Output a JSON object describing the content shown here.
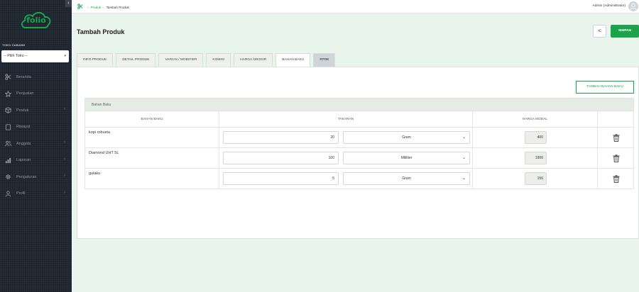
{
  "sidebar": {
    "logo_text": "folio",
    "toko_label": "TOKO CABANG",
    "toko_select": "-- Pilih Toko --",
    "items": [
      {
        "label": "Beranda",
        "icon": "scissors-icon",
        "has_arrow": false
      },
      {
        "label": "Penjualan",
        "icon": "star-icon",
        "has_arrow": false
      },
      {
        "label": "Produk",
        "icon": "box-icon",
        "has_arrow": true
      },
      {
        "label": "Riwayat",
        "icon": "clipboard-icon",
        "has_arrow": false
      },
      {
        "label": "Anggota",
        "icon": "users-icon",
        "has_arrow": true
      },
      {
        "label": "Laporan",
        "icon": "bar-chart-icon",
        "has_arrow": true
      },
      {
        "label": "Pengaturan",
        "icon": "gear-icon",
        "has_arrow": true
      },
      {
        "label": "Profil",
        "icon": "user-icon",
        "has_arrow": true
      }
    ]
  },
  "topbar": {
    "crumb_link": "Produk",
    "crumb_current": "Tambah Produk",
    "admin": "Admin (Administrator)"
  },
  "header": {
    "title": "Tambah Produk",
    "back_label": "<",
    "save_label": "SIMPAN"
  },
  "tabs": [
    {
      "label": "INFO PRODUK",
      "state": "normal"
    },
    {
      "label": "DETAIL PRODUK",
      "state": "normal"
    },
    {
      "label": "VARIAN / MODIFIER",
      "state": "normal"
    },
    {
      "label": "KOMISI",
      "state": "normal"
    },
    {
      "label": "HARGA GROSIR",
      "state": "normal"
    },
    {
      "label": "BAHAN BAKU",
      "state": "active"
    },
    {
      "label": "STOK",
      "state": "stok"
    }
  ],
  "bahan_baku": {
    "add_label": "TAMBAH BAHAN BAKU",
    "section_title": "Bahan Baku",
    "columns": [
      "BAHAN BAKU",
      "TAKARAN",
      "HARGA MODAL"
    ],
    "rows": [
      {
        "name": "kopi robusta",
        "qty": "20",
        "unit": "Gram",
        "price": "400"
      },
      {
        "name": "Diamond UHT 5L",
        "qty": "100",
        "unit": "Mililiter",
        "price": "1900"
      },
      {
        "name": "gulaku",
        "qty": "5",
        "unit": "Gram",
        "price": "156"
      }
    ]
  },
  "colors": {
    "accent": "#1aa34a",
    "sidebar_bg": "#1e2530",
    "page_bg": "#e9f5ec"
  }
}
